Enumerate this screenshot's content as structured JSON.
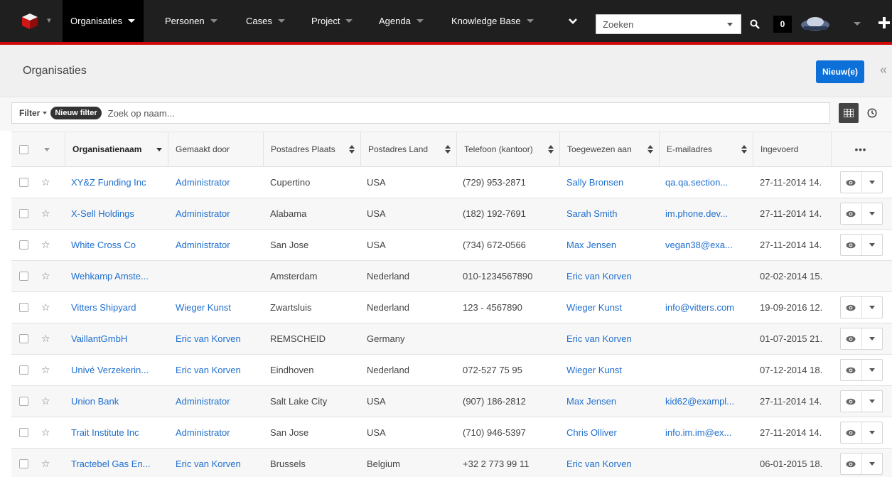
{
  "nav": {
    "items": [
      {
        "label": "Organisaties"
      },
      {
        "label": "Personen"
      },
      {
        "label": "Cases"
      },
      {
        "label": "Project"
      },
      {
        "label": "Agenda"
      },
      {
        "label": "Knowledge Base"
      }
    ],
    "search_placeholder": "Zoeken",
    "notification_count": "0",
    "icons": {
      "logo": "cube-logo-icon",
      "more": "chevron-down-icon",
      "search": "search-icon",
      "add": "plus-icon"
    }
  },
  "header": {
    "title": "Organisaties",
    "new_button": "Nieuw(e)",
    "collapse_icon": "«"
  },
  "filterbar": {
    "filter_label": "Filter",
    "new_filter_tag": "Nieuw filter",
    "search_placeholder": "Zoek op naam..."
  },
  "table": {
    "columns": [
      "Organisatienaam",
      "Gemaakt door",
      "Postadres Plaats",
      "Postadres Land",
      "Telefoon (kantoor)",
      "Toegewezen aan",
      "E-mailadres",
      "Ingevoerd"
    ],
    "more_label": "•••",
    "rows": [
      {
        "name": "XY&Z Funding Inc",
        "created_by": "Administrator",
        "city": "Cupertino",
        "country": "USA",
        "phone": "(729) 953-2871",
        "assigned": "Sally Bronsen",
        "email": "qa.qa.section...",
        "entered": "27-11-2014 14."
      },
      {
        "name": "X-Sell Holdings",
        "created_by": "Administrator",
        "city": "Alabama",
        "country": "USA",
        "phone": "(182) 192-7691",
        "assigned": "Sarah Smith",
        "email": "im.phone.dev...",
        "entered": "27-11-2014 14."
      },
      {
        "name": "White Cross Co",
        "created_by": "Administrator",
        "city": "San Jose",
        "country": "USA",
        "phone": "(734) 672-0566",
        "assigned": "Max Jensen",
        "email": "vegan38@exa...",
        "entered": "27-11-2014 14."
      },
      {
        "name": "Wehkamp Amste...",
        "created_by": "",
        "city": "Amsterdam",
        "country": "Nederland",
        "phone": "010-1234567890",
        "assigned": "Eric van Korven",
        "email": "",
        "entered": "02-02-2014 15."
      },
      {
        "name": "Vitters Shipyard",
        "created_by": "Wieger Kunst",
        "city": "Zwartsluis",
        "country": "Nederland",
        "phone": "123 - 4567890",
        "assigned": "Wieger Kunst",
        "email": "info@vitters.com",
        "entered": "19-09-2016 12."
      },
      {
        "name": "VaillantGmbH",
        "created_by": "Eric van Korven",
        "city": "REMSCHEID",
        "country": "Germany",
        "phone": "",
        "assigned": "Eric van Korven",
        "email": "",
        "entered": "01-07-2015 21."
      },
      {
        "name": "Univé Verzekerin...",
        "created_by": "Eric van Korven",
        "city": "Eindhoven",
        "country": "Nederland",
        "phone": "072-527 75 95",
        "assigned": "Wieger Kunst",
        "email": "",
        "entered": "07-12-2014 18."
      },
      {
        "name": "Union Bank",
        "created_by": "Administrator",
        "city": "Salt Lake City",
        "country": "USA",
        "phone": "(907) 186-2812",
        "assigned": "Max Jensen",
        "email": "kid62@exampl...",
        "entered": "27-11-2014 14."
      },
      {
        "name": "Trait Institute Inc",
        "created_by": "Administrator",
        "city": "San Jose",
        "country": "USA",
        "phone": "(710) 946-5397",
        "assigned": "Chris Olliver",
        "email": "info.im.im@ex...",
        "entered": "27-11-2014 14."
      },
      {
        "name": "Tractebel Gas En...",
        "created_by": "Eric van Korven",
        "city": "Brussels",
        "country": "Belgium",
        "phone": "+32 2 773 99 11",
        "assigned": "Eric van Korven",
        "email": "",
        "entered": "06-01-2015 18."
      }
    ]
  },
  "colors": {
    "accent": "#0d6fd8",
    "topbar": "#1f1f1f",
    "brand_red": "#cf0a0a",
    "link": "#1f6fcf"
  }
}
